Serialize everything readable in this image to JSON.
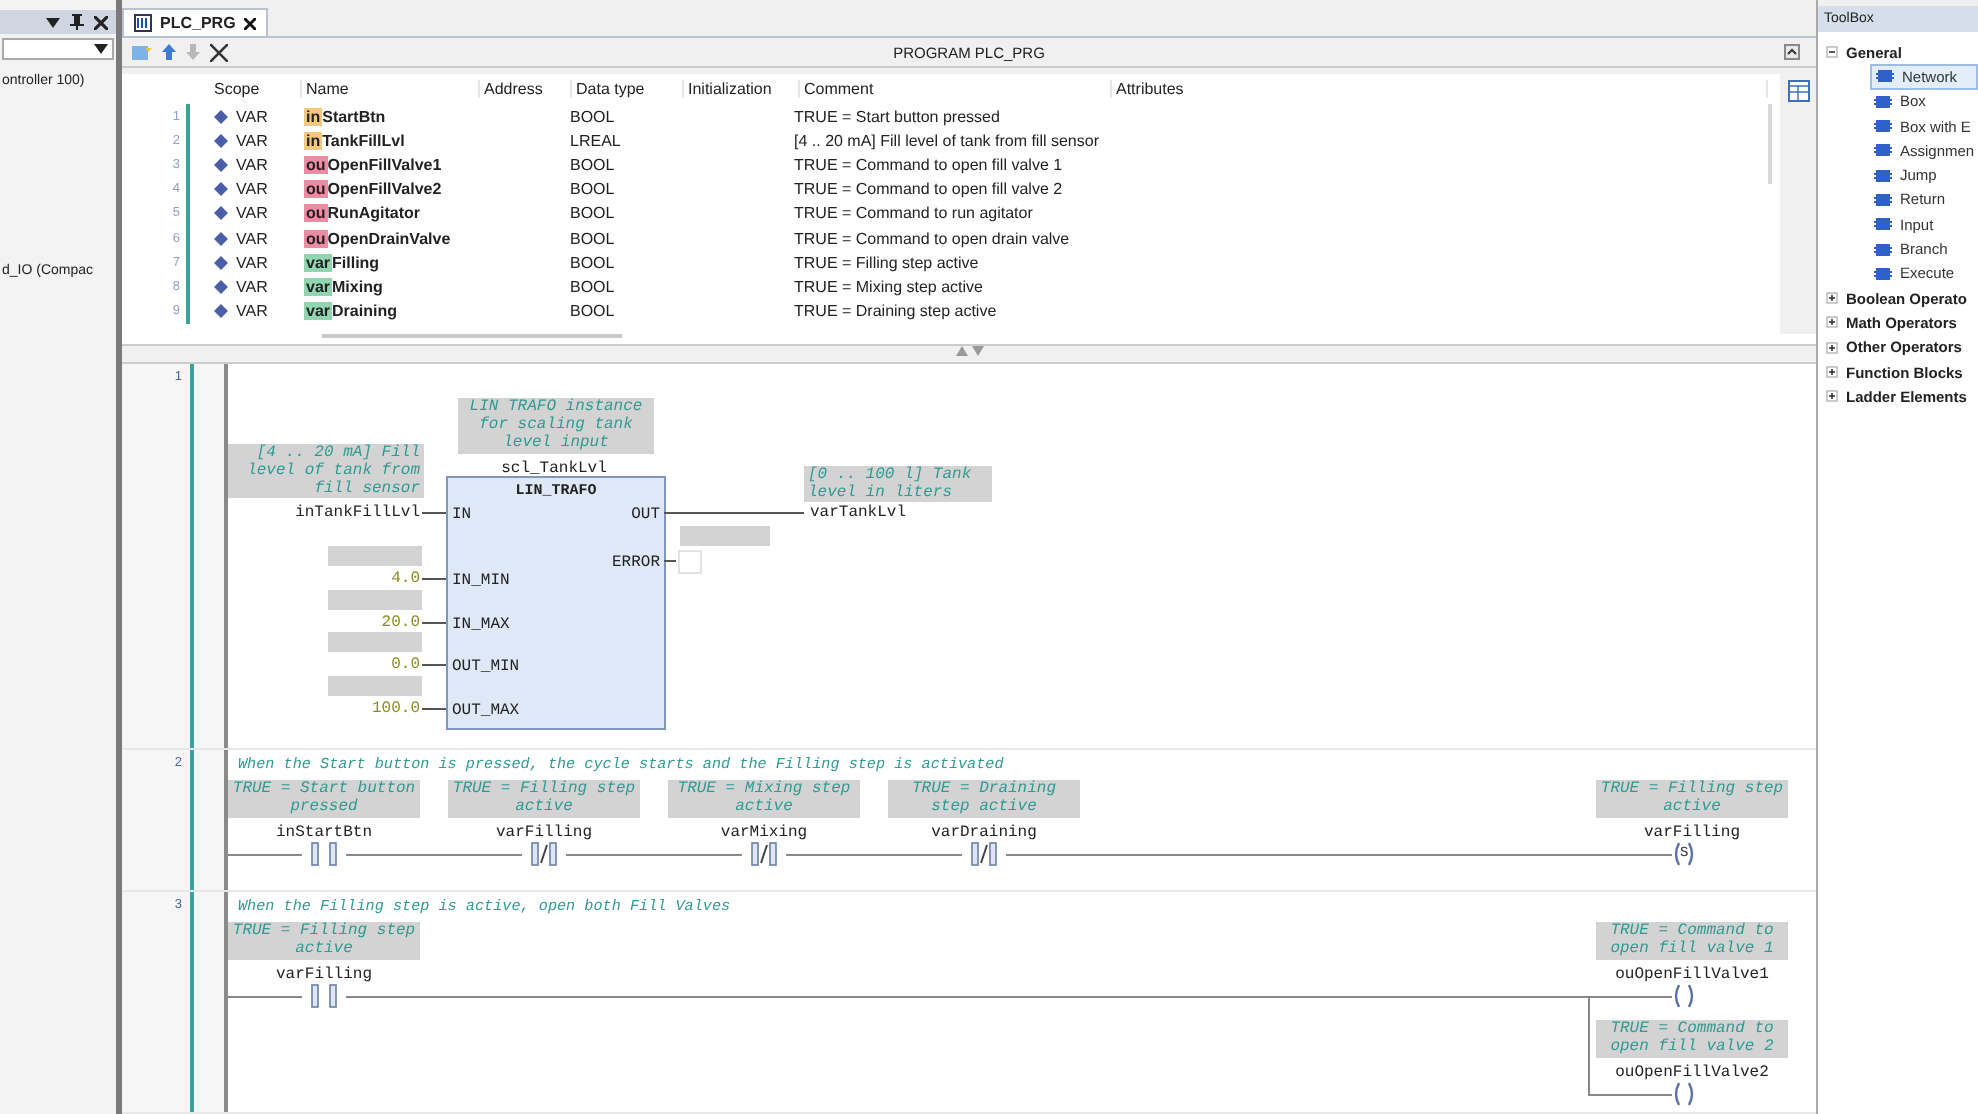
{
  "left_panel": {
    "items": [
      "ontroller 100)",
      "d_IO (Compac"
    ]
  },
  "editor_tab": {
    "label": "PLC_PRG",
    "selected": true
  },
  "editor_title": "PROGRAM PLC_PRG",
  "declarations": {
    "columns": [
      "Scope",
      "Name",
      "Address",
      "Data type",
      "Initialization",
      "Comment",
      "Attributes"
    ],
    "rows": [
      {
        "line": "1",
        "scope": "VAR",
        "prefix": "in",
        "name": "StartBtn",
        "color": "#f5c77e",
        "data_type": "BOOL",
        "comment": "TRUE = Start button pressed"
      },
      {
        "line": "2",
        "scope": "VAR",
        "prefix": "in",
        "name": "TankFillLvl",
        "color": "#f5c77e",
        "data_type": "LREAL",
        "comment": "[4 .. 20 mA] Fill level of tank from fill sensor"
      },
      {
        "line": "3",
        "scope": "VAR",
        "prefix": "ou",
        "name": "OpenFillValve1",
        "color": "#ec8ba2",
        "data_type": "BOOL",
        "comment": "TRUE = Command to open fill valve 1"
      },
      {
        "line": "4",
        "scope": "VAR",
        "prefix": "ou",
        "name": "OpenFillValve2",
        "color": "#ec8ba2",
        "data_type": "BOOL",
        "comment": "TRUE = Command to open fill valve 2"
      },
      {
        "line": "5",
        "scope": "VAR",
        "prefix": "ou",
        "name": "RunAgitator",
        "color": "#ec8ba2",
        "data_type": "BOOL",
        "comment": "TRUE = Command to run agitator"
      },
      {
        "line": "6",
        "scope": "VAR",
        "prefix": "ou",
        "name": "OpenDrainValve",
        "color": "#ec8ba2",
        "data_type": "BOOL",
        "comment": "TRUE = Command to open drain valve"
      },
      {
        "line": "7",
        "scope": "VAR",
        "prefix": "var",
        "name": "Filling",
        "color": "#8fd6b0",
        "data_type": "BOOL",
        "comment": "TRUE = Filling step active"
      },
      {
        "line": "8",
        "scope": "VAR",
        "prefix": "var",
        "name": "Mixing",
        "color": "#8fd6b0",
        "data_type": "BOOL",
        "comment": "TRUE = Mixing step active"
      },
      {
        "line": "9",
        "scope": "VAR",
        "prefix": "var",
        "name": "Draining",
        "color": "#8fd6b0",
        "data_type": "BOOL",
        "comment": "TRUE = Draining step active"
      }
    ]
  },
  "networks": [
    {
      "number": "1",
      "kind": "function_block",
      "block": {
        "instance_comment": "LIN TRAFO instance for scaling tank level input",
        "instance": "scl_TankLvl",
        "type": "LIN_TRAFO",
        "inputs": [
          {
            "pin": "IN",
            "variable": "inTankFillLvl",
            "comment": "[4 .. 20 mA] Fill level of tank from fill sensor"
          },
          {
            "pin": "IN_MIN",
            "value": "4.0"
          },
          {
            "pin": "IN_MAX",
            "value": "20.0"
          },
          {
            "pin": "OUT_MIN",
            "value": "0.0"
          },
          {
            "pin": "OUT_MAX",
            "value": "100.0"
          }
        ],
        "outputs": [
          {
            "pin": "OUT",
            "variable": "varTankLvl",
            "comment": "[0 .. 100 l] Tank level in liters"
          },
          {
            "pin": "ERROR"
          }
        ]
      }
    },
    {
      "number": "2",
      "kind": "rung",
      "comment": "When the Start button is pressed, the cycle starts and the Filling step is activated",
      "contacts": [
        {
          "variable": "inStartBtn",
          "comment": "TRUE = Start button pressed",
          "negated": false
        },
        {
          "variable": "varFilling",
          "comment": "TRUE = Filling step active",
          "negated": true
        },
        {
          "variable": "varMixing",
          "comment": "TRUE = Mixing step active",
          "negated": true
        },
        {
          "variable": "varDraining",
          "comment": "TRUE = Draining step active",
          "negated": true
        }
      ],
      "coils": [
        {
          "variable": "varFilling",
          "comment": "TRUE = Filling step active",
          "letter": "S"
        }
      ]
    },
    {
      "number": "3",
      "kind": "rung",
      "comment": "When the Filling step is active, open both Fill Valves",
      "contacts": [
        {
          "variable": "varFilling",
          "comment": "TRUE = Filling step active",
          "negated": false
        }
      ],
      "coils": [
        {
          "variable": "ouOpenFillValve1",
          "comment": "TRUE = Command to open fill valve 1"
        },
        {
          "variable": "ouOpenFillValve2",
          "comment": "TRUE = Command to open fill valve 2"
        }
      ]
    }
  ],
  "toolbox": {
    "title": "ToolBox",
    "groups": [
      {
        "label": "General",
        "expanded": true,
        "children": [
          {
            "label": "Network",
            "selected": true
          },
          {
            "label": "Box",
            "selected": false
          },
          {
            "label": "Box with E",
            "selected": false
          },
          {
            "label": "Assignmen",
            "selected": false
          },
          {
            "label": "Jump",
            "selected": false
          },
          {
            "label": "Return",
            "selected": false
          },
          {
            "label": "Input",
            "selected": false
          },
          {
            "label": "Branch",
            "selected": false
          },
          {
            "label": "Execute",
            "selected": false
          }
        ]
      },
      {
        "label": "Boolean Operato",
        "expanded": false
      },
      {
        "label": "Math Operators",
        "expanded": false
      },
      {
        "label": "Other Operators",
        "expanded": false
      },
      {
        "label": "Function Blocks",
        "expanded": false
      },
      {
        "label": "Ladder Elements",
        "expanded": false
      }
    ]
  }
}
